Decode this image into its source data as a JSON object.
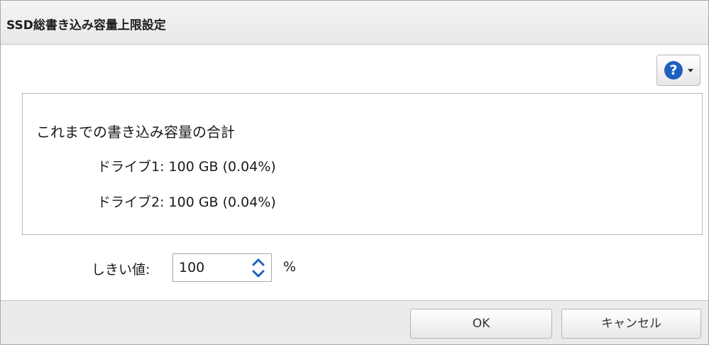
{
  "dialog": {
    "title": "SSD総書き込み容量上限設定"
  },
  "help": {
    "icon_glyph": "?",
    "icon_name": "help-icon",
    "accent_color": "#1f5fbf"
  },
  "info": {
    "heading": "これまでの書き込み容量の合計",
    "drives": [
      {
        "label": "ドライブ1: 100 GB (0.04%)"
      },
      {
        "label": "ドライブ2: 100 GB (0.04%)"
      }
    ]
  },
  "threshold": {
    "label": "しきい値:",
    "value": "100",
    "unit": "%"
  },
  "buttons": {
    "ok": "OK",
    "cancel": "キャンセル"
  }
}
